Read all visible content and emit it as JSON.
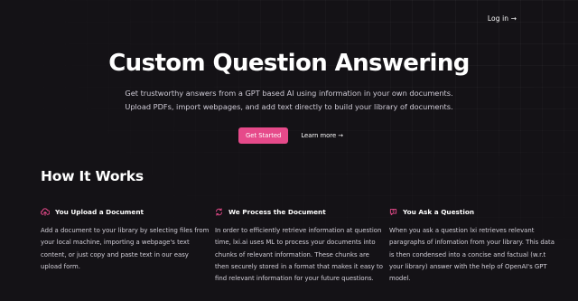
{
  "nav": {
    "login_label": "Log in →"
  },
  "hero": {
    "title": "Custom Question Answering",
    "description": "Get trustworthy answers from a GPT based AI using information in your own documents. Upload PDFs, import webpages, and add text directly to build your library of documents.",
    "primary_button_label": "Get Started",
    "secondary_link_label": "Learn more →"
  },
  "how_it_works": {
    "heading": "How It Works",
    "steps": [
      {
        "icon": "cloud-upload-icon",
        "title": "You Upload a Document",
        "text": "Add a document to your library by selecting files from your local machine, importing a webpage's text content, or just copy and paste text in our easy upload form."
      },
      {
        "icon": "refresh-icon",
        "title": "We Process the Document",
        "text": "In order to efficiently retrieve information at question time, lxi.ai uses ML to process your documents into chunks of relevant information. These chunks are then securely stored in a format that makes it easy to find relevant information for your future questions."
      },
      {
        "icon": "chat-question-icon",
        "title": "You Ask a Question",
        "text": "When you ask a question lxi retrieves relevant paragraphs of infomation from your library. This data is then condensed into a concise and factual (w.r.t your library) answer with the help of OpenAI's GPT model."
      }
    ]
  },
  "colors": {
    "background": "#141216",
    "accent": "#e64a8a",
    "text_primary": "#ffffff",
    "text_secondary": "#cfcbd6"
  }
}
